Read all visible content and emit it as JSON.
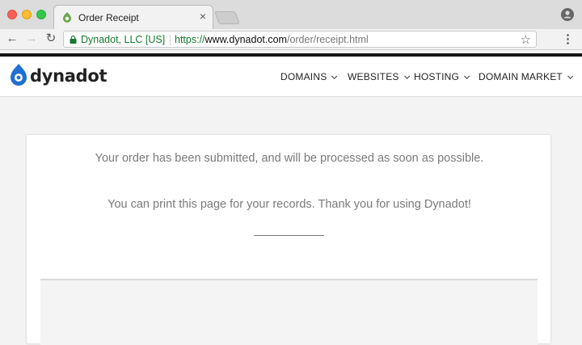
{
  "browser": {
    "tab": {
      "title": "Order Receipt",
      "close_glyph": "×"
    },
    "address_bar": {
      "identity": "Dynadot, LLC [US]",
      "url_scheme": "https://",
      "url_host": "www.dynadot.com",
      "url_path": "/order/receipt.html"
    },
    "icons": {
      "back": "←",
      "forward": "→",
      "reload": "↻",
      "star": "☆",
      "menu": "⋮"
    },
    "colors": {
      "secure_green": "#157a2c"
    }
  },
  "site": {
    "logo_text": "dynadot",
    "brand_color": "#1f6fd0",
    "nav": [
      {
        "label": "DOMAINS"
      },
      {
        "label": "WEBSITES"
      },
      {
        "label": "HOSTING"
      },
      {
        "label": "DOMAIN MARKET"
      }
    ]
  },
  "receipt": {
    "message_1": "Your order has been submitted, and will be processed as soon as possible.",
    "message_2": "You can print this page for your records. Thank you for using Dynadot!"
  }
}
